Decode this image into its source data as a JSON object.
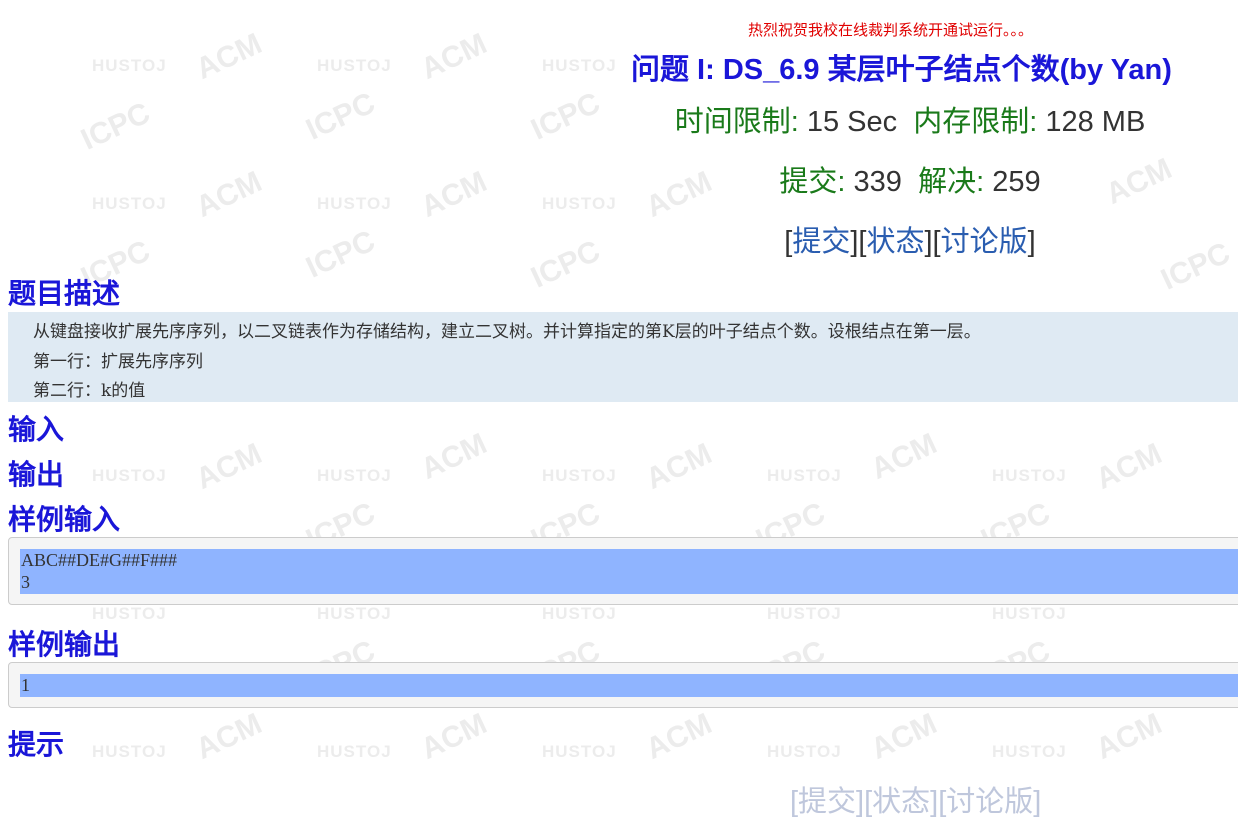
{
  "notice": "热烈祝贺我校在线裁判系统开通试运行。。。",
  "problem": {
    "title": "问题 I: DS_6.9 某层叶子结点个数(by Yan)",
    "time_limit_label": "时间限制:",
    "time_limit_value": "15 Sec",
    "memory_limit_label": "内存限制:",
    "memory_limit_value": "128 MB",
    "submit_label": "提交:",
    "submit_value": "339",
    "solved_label": "解决:",
    "solved_value": "259"
  },
  "links": {
    "submit": "提交",
    "status": "状态",
    "discuss": "讨论版"
  },
  "sections": {
    "description": "题目描述",
    "input": "输入",
    "output": "输出",
    "sample_input": "样例输入",
    "sample_output": "样例输出",
    "hint": "提示"
  },
  "description_lines": [
    "从键盘接收扩展先序序列，以二叉链表作为存储结构，建立二叉树。并计算指定的第K层的叶子结点个数。设根结点在第一层。",
    "第一行：扩展先序序列",
    "第二行：k的值"
  ],
  "sample_input_lines": [
    "ABC##DE#G##F###",
    "3"
  ],
  "sample_output_lines": [
    "1"
  ],
  "bottom_links": "[提交][状态][讨论版]",
  "watermark": {
    "a": "HUSTOJ",
    "b": "ACM",
    "c": "ICPC"
  },
  "colors": {
    "title_blue": "#1a16d8",
    "label_green": "#1a7a1a",
    "link_blue": "#2a5db0",
    "notice_red": "#e00000",
    "desc_bg": "#dfeaf3",
    "highlight": "#8fb4ff"
  }
}
